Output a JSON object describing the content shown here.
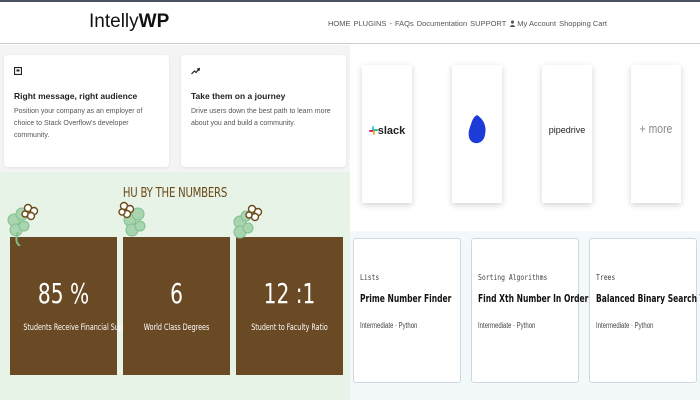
{
  "header": {
    "logo_prefix": "Intelly",
    "logo_suffix": "WP",
    "nav": [
      "HOME",
      "PLUGINS",
      "-",
      "FAQs",
      "Documentation",
      "SUPPORT",
      "My Account",
      "Shopping Cart"
    ]
  },
  "features": [
    {
      "icon": "message-icon",
      "title": "Right message, right audience",
      "text": "Position your company as an employer of choice to Stack Overflow's developer community."
    },
    {
      "icon": "trend-up-icon",
      "title": "Take them on a journey",
      "text": "Drive users down the best path to learn more about you and build a community."
    }
  ],
  "numbers": {
    "title": "HU BY THE NUMBERS",
    "stats": [
      {
        "value": "85 %",
        "label": "Students Receive Financial Support"
      },
      {
        "value": "6",
        "label": "World Class Degrees"
      },
      {
        "value": "12 :1",
        "label": "Student to Faculty Ratio"
      }
    ]
  },
  "integrations": {
    "items": [
      "slack",
      "",
      "pipedrive",
      "+ more"
    ]
  },
  "courses": [
    {
      "category": "Lists",
      "title": "Prime Number Finder",
      "meta": "Intermediate · Python"
    },
    {
      "category": "Sorting Algorithms",
      "title": "Find Xth Number In Order",
      "meta": "Intermediate · Python"
    },
    {
      "category": "Trees",
      "title": "Balanced Binary Search Tree",
      "meta": "Intermediate · Python"
    }
  ],
  "colors": {
    "stat_bg": "#6a4a24",
    "numbers_bg": "#e7f3e6",
    "title_brown": "#6b4a1a",
    "clover_green": "#a8d5b0"
  }
}
